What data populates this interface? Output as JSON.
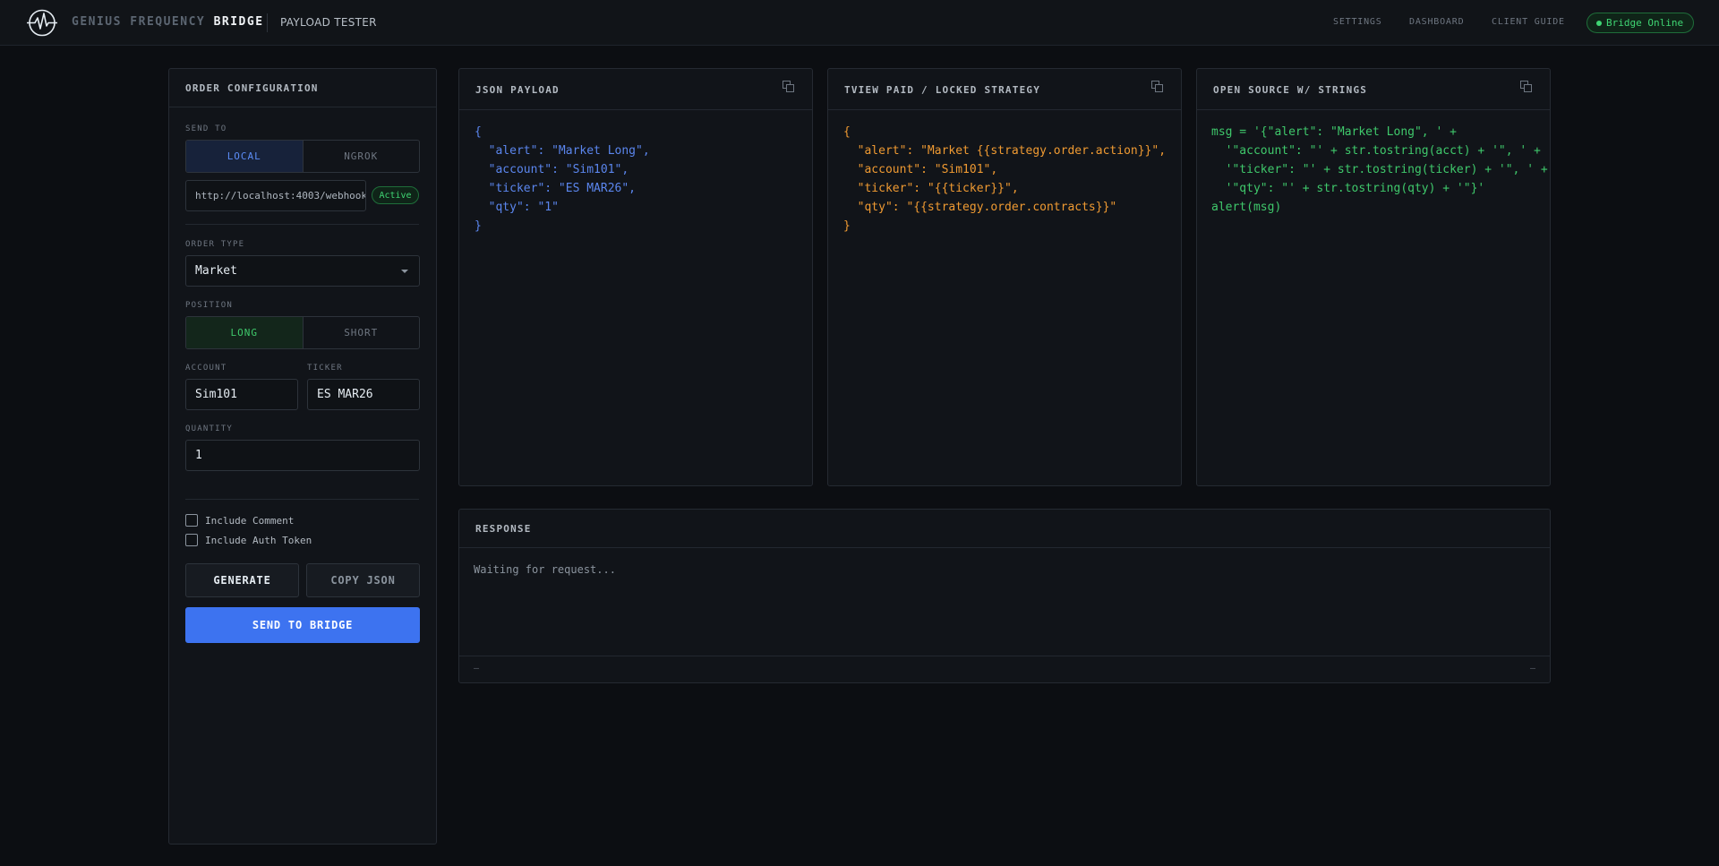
{
  "header": {
    "brand_dim": "GENIUS FREQUENCY",
    "brand_bright": "BRIDGE",
    "subtitle": "PAYLOAD TESTER",
    "nav": [
      "SETTINGS",
      "DASHBOARD",
      "CLIENT GUIDE"
    ],
    "status": "Bridge Online",
    "status_color": "#3fd573"
  },
  "order_config": {
    "title": "ORDER CONFIGURATION",
    "send_to_label": "SEND TO",
    "send_to_options": [
      "LOCAL",
      "NGROK"
    ],
    "send_to_selected": "LOCAL",
    "url_value": "http://localhost:4003/webhook",
    "url_status": "Active",
    "order_type_label": "ORDER TYPE",
    "order_type_value": "Market",
    "position_label": "POSITION",
    "position_options": [
      "LONG",
      "SHORT"
    ],
    "position_selected": "LONG",
    "account_label": "ACCOUNT",
    "account_value": "Sim101",
    "ticker_label": "TICKER",
    "ticker_value": "ES MAR26",
    "quantity_label": "QUANTITY",
    "quantity_value": "1",
    "include_comment": "Include Comment",
    "include_auth": "Include Auth Token",
    "generate_label": "GENERATE",
    "copy_json_label": "COPY JSON",
    "send_label": "SEND TO BRIDGE"
  },
  "panels": {
    "json": {
      "title": "JSON PAYLOAD",
      "code": "{\n  \"alert\": \"Market Long\",\n  \"account\": \"Sim101\",\n  \"ticker\": \"ES MAR26\",\n  \"qty\": \"1\"\n}"
    },
    "tview": {
      "title": "TVIEW PAID / LOCKED STRATEGY",
      "code": "{\n  \"alert\": \"Market {{strategy.order.action}}\",\n  \"account\": \"Sim101\",\n  \"ticker\": \"{{ticker}}\",\n  \"qty\": \"{{strategy.order.contracts}}\"\n}"
    },
    "opensource": {
      "title": "OPEN SOURCE W/ STRINGS",
      "code": "msg = '{\"alert\": \"Market Long\", ' +\n  '\"account\": \"' + str.tostring(acct) + '\", ' +\n  '\"ticker\": \"' + str.tostring(ticker) + '\", ' +\n  '\"qty\": \"' + str.tostring(qty) + '\"}'\nalert(msg)"
    }
  },
  "response": {
    "title": "RESPONSE",
    "text": "Waiting for request...",
    "footer_left": "—",
    "footer_right": "—"
  },
  "colors": {
    "accent_blue": "#3d73f0",
    "success_green": "#3fd573",
    "code_orange": "#ef9a32"
  }
}
